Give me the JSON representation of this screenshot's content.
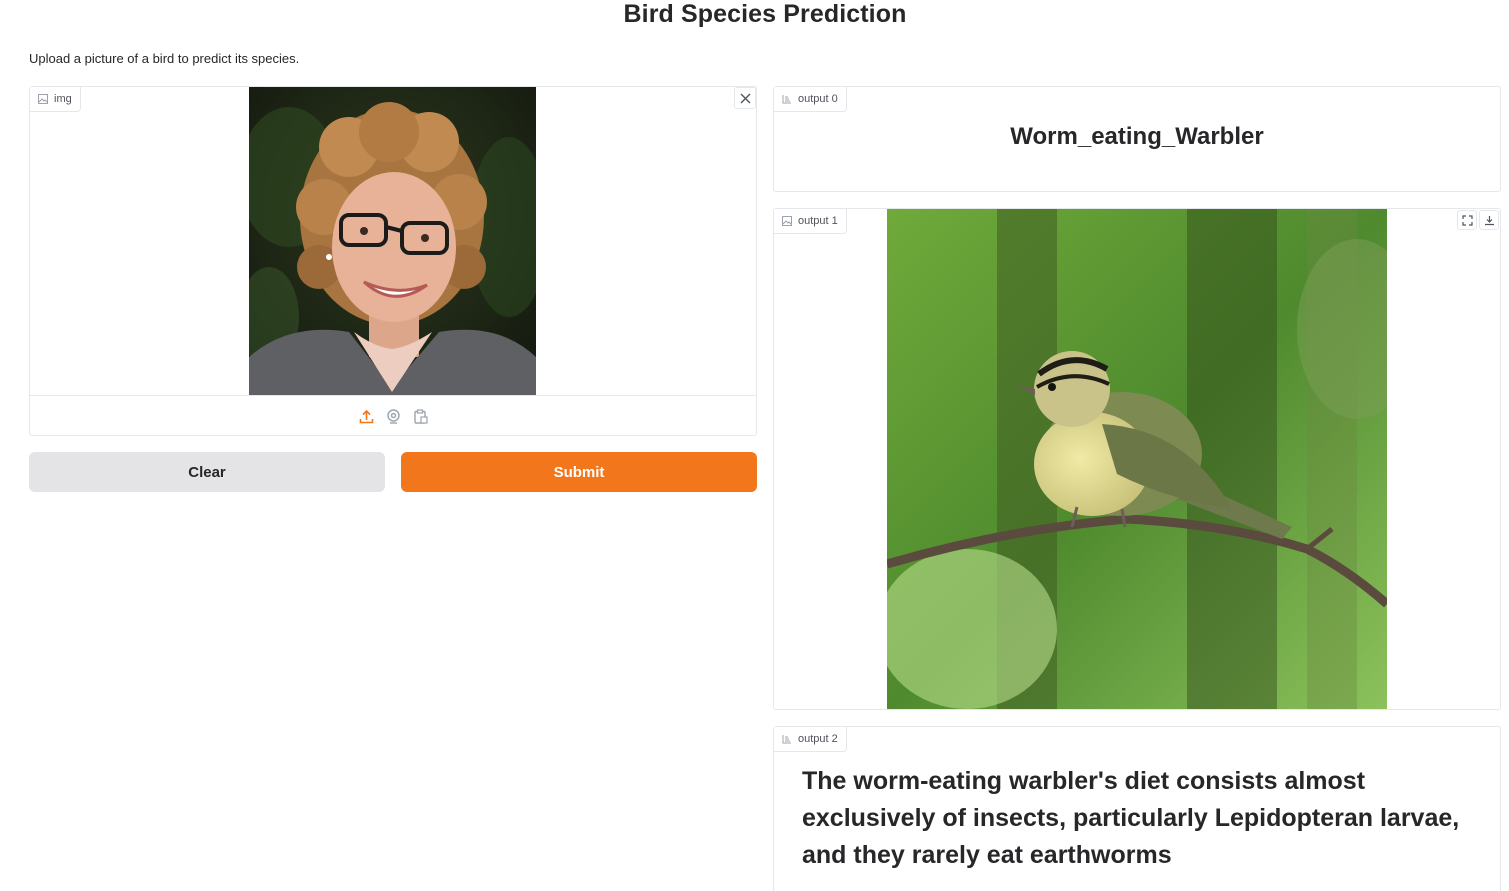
{
  "page": {
    "title": "Bird Species Prediction",
    "description": "Upload a picture of a bird to predict its species."
  },
  "input": {
    "label": "img",
    "image_alt": "Uploaded photo of a smiling woman with curly hair and glasses"
  },
  "buttons": {
    "clear": "Clear",
    "submit": "Submit"
  },
  "outputs": [
    {
      "label": "output 0",
      "text": "Worm_eating_Warbler"
    },
    {
      "label": "output 1",
      "image_alt": "Worm-eating warbler perched on a branch"
    },
    {
      "label": "output 2",
      "text": "The worm-eating warbler's diet consists almost exclusively of insects, particularly Lepidopteran larvae, and they rarely eat earthworms"
    }
  ],
  "colors": {
    "accent": "#f2761b",
    "secondary_button": "#e4e4e7",
    "border": "#e5e7eb"
  },
  "icons": {
    "label_chip": "image-icon",
    "text_label_chip": "text-icon",
    "close": "close-icon",
    "upload": "upload-icon",
    "webcam": "webcam-icon",
    "clipboard": "clipboard-icon",
    "fullscreen": "fullscreen-icon",
    "download": "download-icon"
  }
}
